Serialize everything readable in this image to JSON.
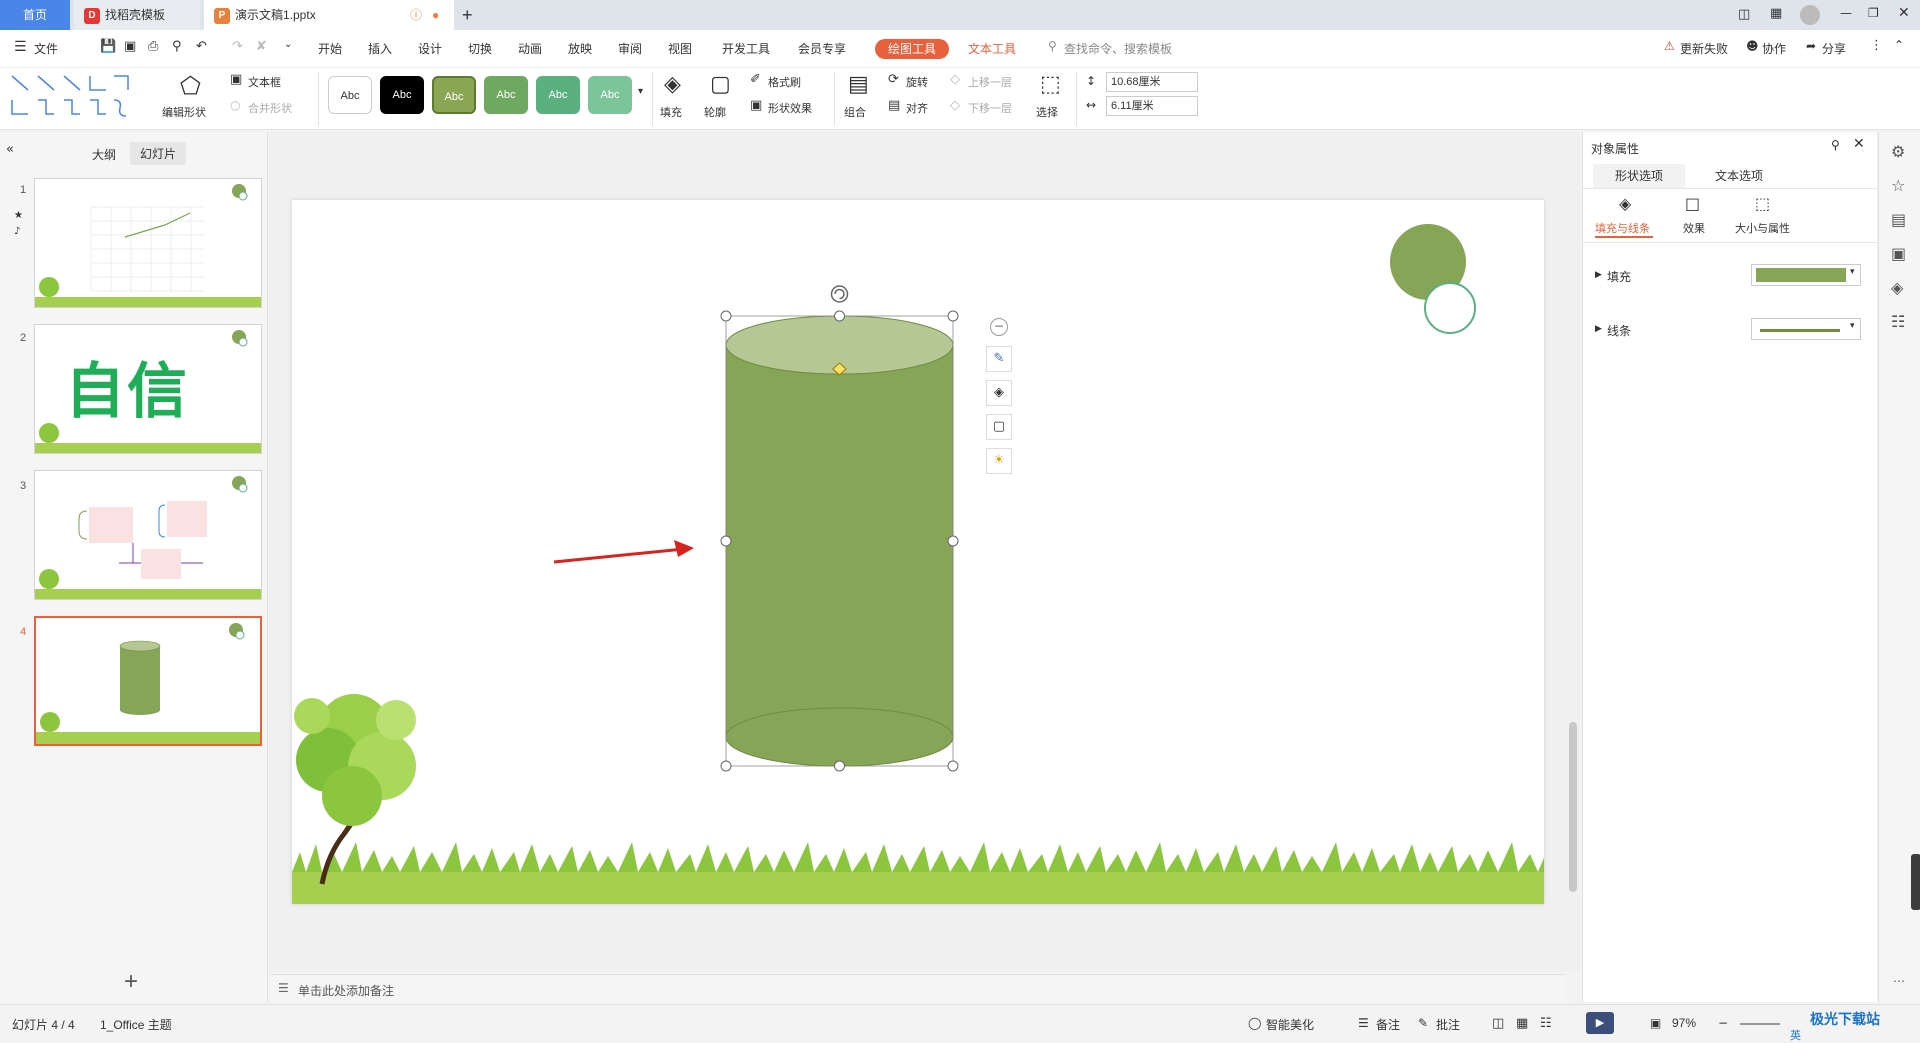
{
  "tabs": {
    "home": "首页",
    "template": "找稻壳模板",
    "doc": "演示文稿1.pptx",
    "new_tab": "+"
  },
  "menu": {
    "file": "文件",
    "items": [
      "开始",
      "插入",
      "设计",
      "切换",
      "动画",
      "放映",
      "审阅",
      "视图",
      "开发工具",
      "会员专享"
    ],
    "drawing_tools": "绘图工具",
    "text_tools": "文本工具",
    "search": "查找命令、搜索模板",
    "update_failed": "更新失败",
    "collab": "协作",
    "share": "分享"
  },
  "ribbon": {
    "edit_shape": "编辑形状",
    "textbox": "文本框",
    "merge_shape": "合并形状",
    "styles": [
      "Abc",
      "Abc",
      "Abc",
      "Abc",
      "Abc",
      "Abc"
    ],
    "fill": "填充",
    "outline": "轮廓",
    "format_brush": "格式刷",
    "shape_effect": "形状效果",
    "group": "组合",
    "rotate": "旋转",
    "align": "对齐",
    "bring_forward": "上移一层",
    "send_backward": "下移一层",
    "select": "选择",
    "height": "10.68厘米",
    "width": "6.11厘米"
  },
  "leftpane": {
    "outline": "大纲",
    "slides": "幻灯片",
    "slide_numbers": [
      "1",
      "2",
      "3",
      "4"
    ],
    "slide2_text": "自信",
    "add": "+"
  },
  "notes": {
    "placeholder": "单击此处添加备注"
  },
  "rightpane": {
    "title": "对象属性",
    "tab_shape": "形状选项",
    "tab_text": "文本选项",
    "sub_fill_line": "填充与线条",
    "sub_effect": "效果",
    "sub_size": "大小与属性",
    "fill": "填充",
    "line": "线条"
  },
  "status": {
    "slide_info": "幻灯片 4 / 4",
    "theme": "1_Office 主题",
    "smart": "智能美化",
    "notes": "备注",
    "comments": "批注",
    "zoom": "97%"
  },
  "watermark": {
    "site": "极光下载站",
    "ime": "英"
  },
  "colors": {
    "shape_fill": "#86a556",
    "shape_top": "#b4c795",
    "accent_orange": "#e8613c",
    "tab_blue": "#4a86e8",
    "arrow_red": "#d9231f"
  }
}
